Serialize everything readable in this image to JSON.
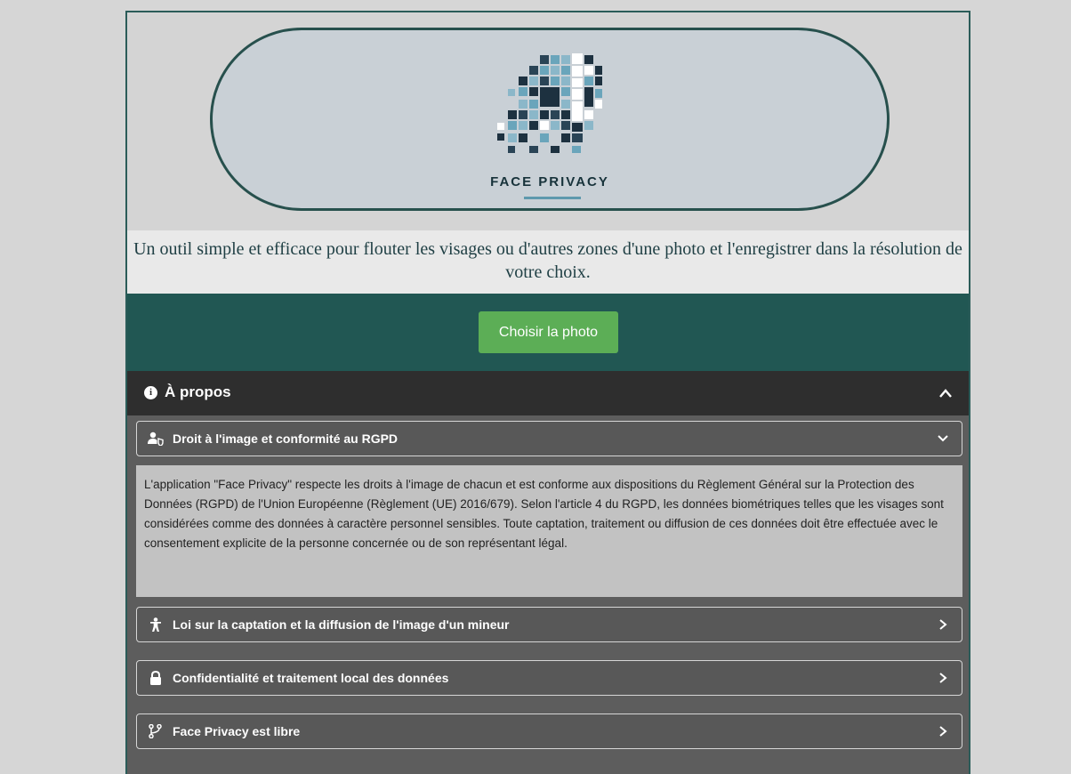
{
  "brand": {
    "name": "FACE PRIVACY"
  },
  "tagline": "Un outil simple et efficace pour flouter les visages ou d'autres zones d'une photo et l'enregistrer dans la résolution de votre choix.",
  "cta": {
    "label": "Choisir la photo"
  },
  "about": {
    "title": "À propos",
    "sections": [
      {
        "icon": "user-shield-icon",
        "label": "Droit à l'image et conformité au RGPD",
        "expanded": true,
        "content": "L'application \"Face Privacy\" respecte les droits à l'image de chacun et est conforme aux dispositions du Règlement Général sur la Protection des Données (RGPD) de l'Union Européenne (Règlement (UE) 2016/679). Selon l'article 4 du RGPD, les données biométriques telles que les visages sont considérées comme des données à caractère personnel sensibles. Toute captation, traitement ou diffusion de ces données doit être effectuée avec le consentement explicite de la personne concernée ou de son représentant légal."
      },
      {
        "icon": "child-icon",
        "label": "Loi sur la captation et la diffusion de l'image d'un mineur",
        "expanded": false
      },
      {
        "icon": "lock-icon",
        "label": "Confidentialité et traitement local des données",
        "expanded": false
      },
      {
        "icon": "code-branch-icon",
        "label": "Face Privacy est libre",
        "expanded": false
      }
    ]
  },
  "colors": {
    "header_bg": "#d4d4d4",
    "accent_dark": "#215753",
    "button_green": "#5cae56",
    "about_header": "#2e2e2e",
    "panel_gray": "#5d5d5d"
  }
}
